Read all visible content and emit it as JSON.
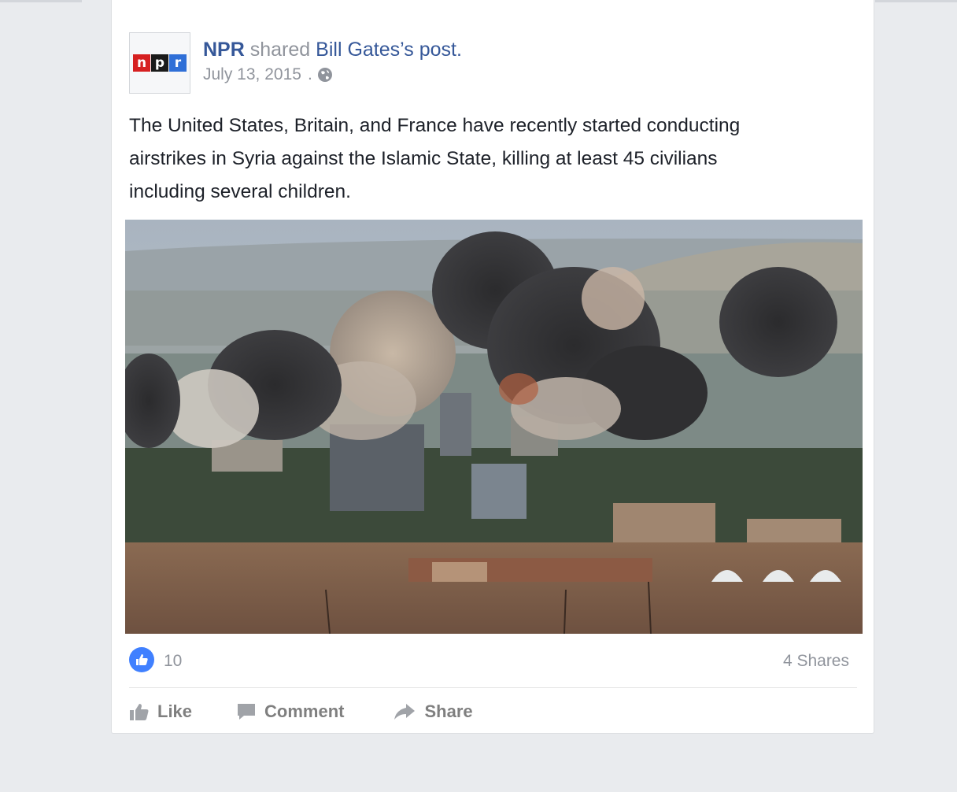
{
  "post": {
    "page_name": "NPR",
    "shared_word": "shared",
    "source_name": "Bill Gates",
    "possessive": "’s",
    "post_word": "post.",
    "date": "July 13, 2015",
    "dot": ".",
    "privacy_icon": "globe-icon",
    "avatar_logo": [
      "n",
      "p",
      "r"
    ],
    "body_lines": [
      "The United States, Britain, and France have recently started conducting",
      "airstrikes in Syria against the Islamic State, killing at least 45 civilians",
      "including several children."
    ]
  },
  "stats": {
    "like_icon": "thumbs-up-icon",
    "like_count": "10",
    "shares": "4 Shares"
  },
  "actions": {
    "like": "Like",
    "comment": "Comment",
    "share": "Share"
  },
  "colors": {
    "link": "#365899",
    "muted": "#90949c",
    "like_blue": "#4080ff",
    "background": "#e9ebee"
  }
}
